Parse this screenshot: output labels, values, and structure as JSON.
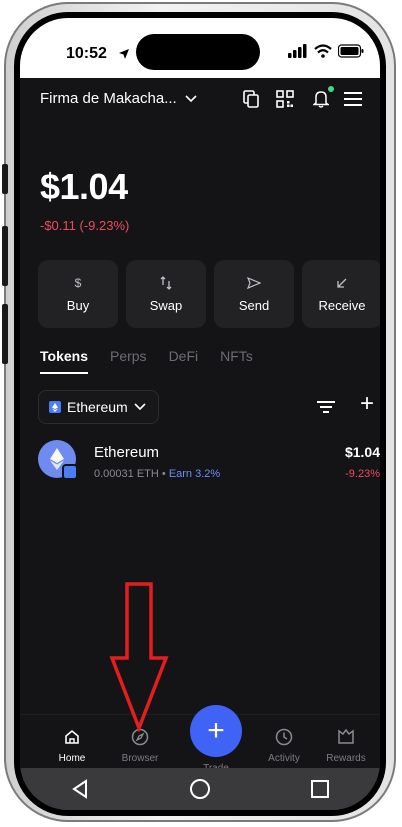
{
  "status": {
    "time": "10:52"
  },
  "header": {
    "wallet_name": "Firma de Makacha..."
  },
  "balance": {
    "amount": "$1.04",
    "change": "-$0.11 (-9.23%)"
  },
  "actions": [
    {
      "label": "Buy",
      "icon": "dollar-icon"
    },
    {
      "label": "Swap",
      "icon": "swap-icon"
    },
    {
      "label": "Send",
      "icon": "send-icon"
    },
    {
      "label": "Receive",
      "icon": "receive-icon"
    }
  ],
  "tabs": [
    {
      "label": "Tokens",
      "active": true
    },
    {
      "label": "Perps"
    },
    {
      "label": "DeFi"
    },
    {
      "label": "NFTs"
    }
  ],
  "network": {
    "selected": "Ethereum"
  },
  "tokens": [
    {
      "name": "Ethereum",
      "amount": "0.00031 ETH",
      "separator": "•",
      "earn": "Earn 3.2%",
      "value": "$1.04",
      "change": "-9.23%"
    }
  ],
  "bottom_nav": {
    "home": "Home",
    "browser": "Browser",
    "trade": "Trade",
    "activity": "Activity",
    "rewards": "Rewards"
  },
  "colors": {
    "accent": "#3f63f5",
    "negative": "#ef4b5b",
    "background": "#141416",
    "annotation_arrow": "#e41e1e"
  }
}
